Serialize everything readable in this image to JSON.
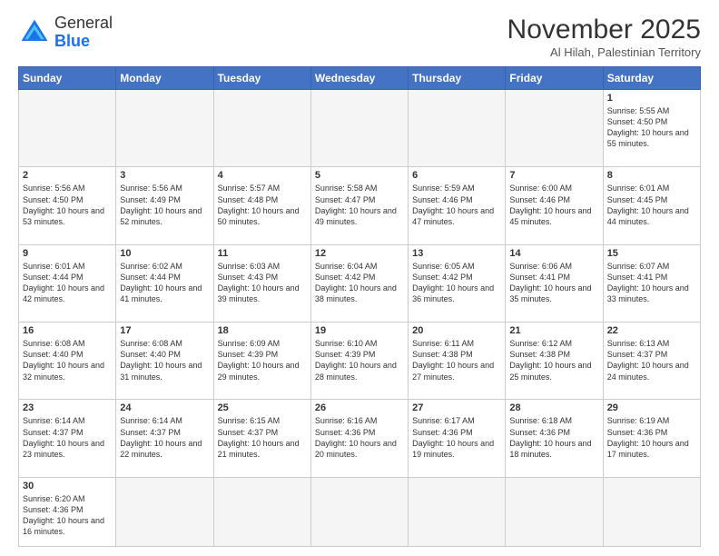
{
  "header": {
    "logo_general": "General",
    "logo_blue": "Blue",
    "month": "November 2025",
    "location": "Al Hilah, Palestinian Territory"
  },
  "days_of_week": [
    "Sunday",
    "Monday",
    "Tuesday",
    "Wednesday",
    "Thursday",
    "Friday",
    "Saturday"
  ],
  "weeks": [
    [
      {
        "day": "",
        "info": "",
        "empty": true
      },
      {
        "day": "",
        "info": "",
        "empty": true
      },
      {
        "day": "",
        "info": "",
        "empty": true
      },
      {
        "day": "",
        "info": "",
        "empty": true
      },
      {
        "day": "",
        "info": "",
        "empty": true
      },
      {
        "day": "",
        "info": "",
        "empty": true
      },
      {
        "day": "1",
        "info": "Sunrise: 5:55 AM\nSunset: 4:50 PM\nDaylight: 10 hours\nand 55 minutes."
      }
    ],
    [
      {
        "day": "2",
        "info": "Sunrise: 5:56 AM\nSunset: 4:50 PM\nDaylight: 10 hours\nand 53 minutes."
      },
      {
        "day": "3",
        "info": "Sunrise: 5:56 AM\nSunset: 4:49 PM\nDaylight: 10 hours\nand 52 minutes."
      },
      {
        "day": "4",
        "info": "Sunrise: 5:57 AM\nSunset: 4:48 PM\nDaylight: 10 hours\nand 50 minutes."
      },
      {
        "day": "5",
        "info": "Sunrise: 5:58 AM\nSunset: 4:47 PM\nDaylight: 10 hours\nand 49 minutes."
      },
      {
        "day": "6",
        "info": "Sunrise: 5:59 AM\nSunset: 4:46 PM\nDaylight: 10 hours\nand 47 minutes."
      },
      {
        "day": "7",
        "info": "Sunrise: 6:00 AM\nSunset: 4:46 PM\nDaylight: 10 hours\nand 45 minutes."
      },
      {
        "day": "8",
        "info": "Sunrise: 6:01 AM\nSunset: 4:45 PM\nDaylight: 10 hours\nand 44 minutes."
      }
    ],
    [
      {
        "day": "9",
        "info": "Sunrise: 6:01 AM\nSunset: 4:44 PM\nDaylight: 10 hours\nand 42 minutes."
      },
      {
        "day": "10",
        "info": "Sunrise: 6:02 AM\nSunset: 4:44 PM\nDaylight: 10 hours\nand 41 minutes."
      },
      {
        "day": "11",
        "info": "Sunrise: 6:03 AM\nSunset: 4:43 PM\nDaylight: 10 hours\nand 39 minutes."
      },
      {
        "day": "12",
        "info": "Sunrise: 6:04 AM\nSunset: 4:42 PM\nDaylight: 10 hours\nand 38 minutes."
      },
      {
        "day": "13",
        "info": "Sunrise: 6:05 AM\nSunset: 4:42 PM\nDaylight: 10 hours\nand 36 minutes."
      },
      {
        "day": "14",
        "info": "Sunrise: 6:06 AM\nSunset: 4:41 PM\nDaylight: 10 hours\nand 35 minutes."
      },
      {
        "day": "15",
        "info": "Sunrise: 6:07 AM\nSunset: 4:41 PM\nDaylight: 10 hours\nand 33 minutes."
      }
    ],
    [
      {
        "day": "16",
        "info": "Sunrise: 6:08 AM\nSunset: 4:40 PM\nDaylight: 10 hours\nand 32 minutes."
      },
      {
        "day": "17",
        "info": "Sunrise: 6:08 AM\nSunset: 4:40 PM\nDaylight: 10 hours\nand 31 minutes."
      },
      {
        "day": "18",
        "info": "Sunrise: 6:09 AM\nSunset: 4:39 PM\nDaylight: 10 hours\nand 29 minutes."
      },
      {
        "day": "19",
        "info": "Sunrise: 6:10 AM\nSunset: 4:39 PM\nDaylight: 10 hours\nand 28 minutes."
      },
      {
        "day": "20",
        "info": "Sunrise: 6:11 AM\nSunset: 4:38 PM\nDaylight: 10 hours\nand 27 minutes."
      },
      {
        "day": "21",
        "info": "Sunrise: 6:12 AM\nSunset: 4:38 PM\nDaylight: 10 hours\nand 25 minutes."
      },
      {
        "day": "22",
        "info": "Sunrise: 6:13 AM\nSunset: 4:37 PM\nDaylight: 10 hours\nand 24 minutes."
      }
    ],
    [
      {
        "day": "23",
        "info": "Sunrise: 6:14 AM\nSunset: 4:37 PM\nDaylight: 10 hours\nand 23 minutes."
      },
      {
        "day": "24",
        "info": "Sunrise: 6:14 AM\nSunset: 4:37 PM\nDaylight: 10 hours\nand 22 minutes."
      },
      {
        "day": "25",
        "info": "Sunrise: 6:15 AM\nSunset: 4:37 PM\nDaylight: 10 hours\nand 21 minutes."
      },
      {
        "day": "26",
        "info": "Sunrise: 6:16 AM\nSunset: 4:36 PM\nDaylight: 10 hours\nand 20 minutes."
      },
      {
        "day": "27",
        "info": "Sunrise: 6:17 AM\nSunset: 4:36 PM\nDaylight: 10 hours\nand 19 minutes."
      },
      {
        "day": "28",
        "info": "Sunrise: 6:18 AM\nSunset: 4:36 PM\nDaylight: 10 hours\nand 18 minutes."
      },
      {
        "day": "29",
        "info": "Sunrise: 6:19 AM\nSunset: 4:36 PM\nDaylight: 10 hours\nand 17 minutes."
      }
    ],
    [
      {
        "day": "30",
        "info": "Sunrise: 6:20 AM\nSunset: 4:36 PM\nDaylight: 10 hours\nand 16 minutes.",
        "last": true
      },
      {
        "day": "",
        "info": "",
        "empty": true,
        "last": true
      },
      {
        "day": "",
        "info": "",
        "empty": true,
        "last": true
      },
      {
        "day": "",
        "info": "",
        "empty": true,
        "last": true
      },
      {
        "day": "",
        "info": "",
        "empty": true,
        "last": true
      },
      {
        "day": "",
        "info": "",
        "empty": true,
        "last": true
      },
      {
        "day": "",
        "info": "",
        "empty": true,
        "last": true
      }
    ]
  ]
}
